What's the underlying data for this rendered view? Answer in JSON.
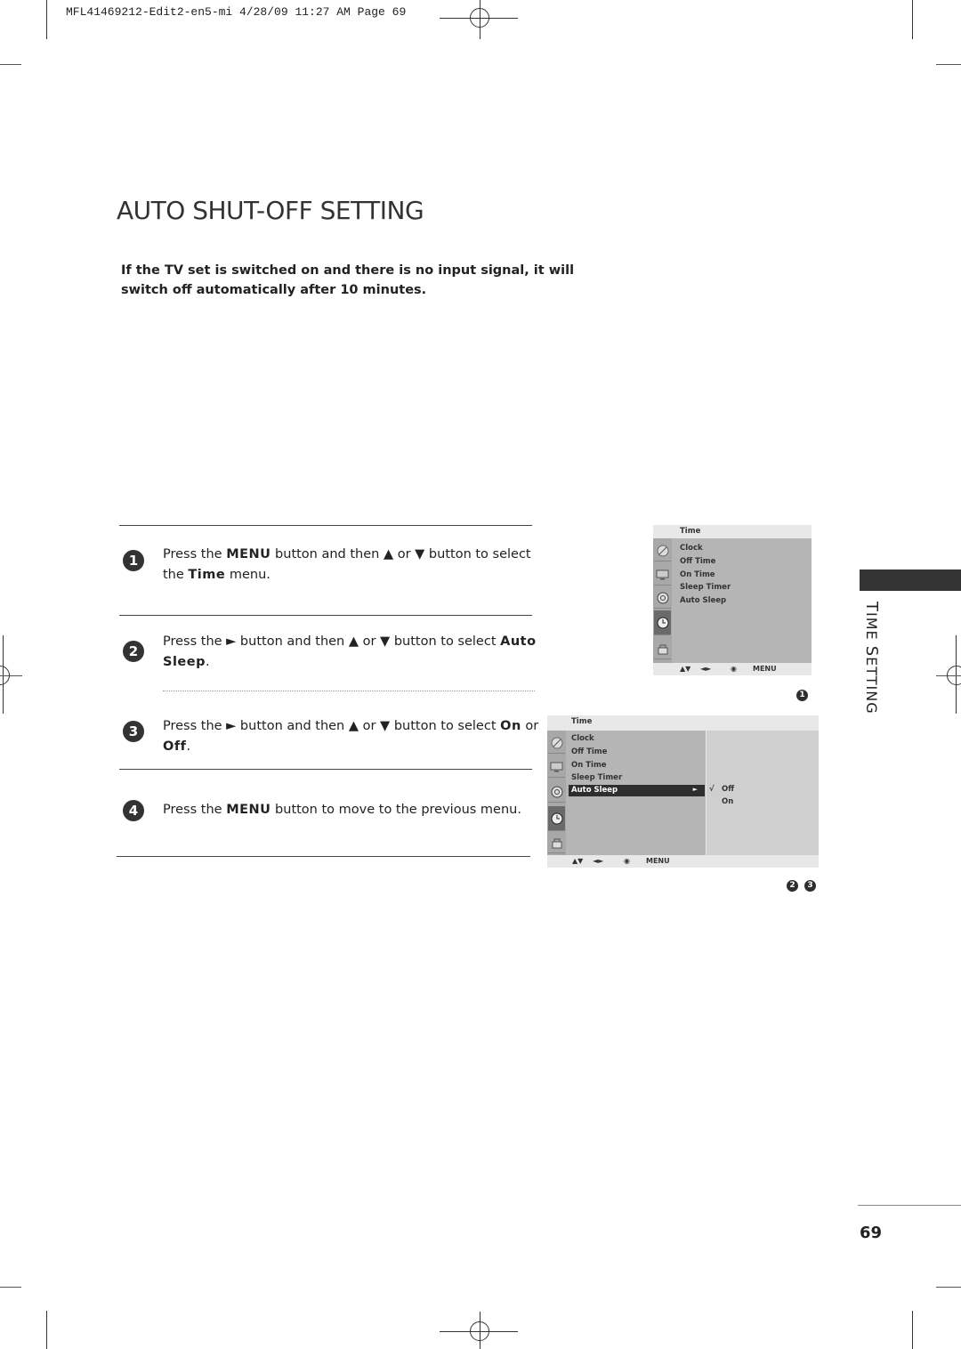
{
  "slug": "MFL41469212-Edit2-en5-mi  4/28/09 11:27 AM  Page 69",
  "title": "AUTO SHUT-OFF SETTING",
  "intro": "If the TV set is switched on and there is no input signal, it will switch off automatically after 10 minutes.",
  "steps": [
    {
      "num": "1",
      "parts": [
        "Press the ",
        "MENU",
        " button and then ▲ or ▼ button to select the ",
        "Time",
        " menu."
      ]
    },
    {
      "num": "2",
      "parts": [
        "Press the ► button and then ▲ or ▼ button to select ",
        "Auto Sleep",
        "."
      ]
    },
    {
      "num": "3",
      "parts": [
        "Press the ► button and then ▲ or ▼ button to select ",
        "On",
        " or ",
        "Off",
        "."
      ]
    },
    {
      "num": "4",
      "parts": [
        "Press the ",
        "MENU",
        " button to move to the previous menu."
      ]
    }
  ],
  "osd1": {
    "header": "Time",
    "items": [
      "Clock",
      "Off Time",
      "On Time",
      "Sleep Timer",
      "Auto Sleep"
    ],
    "side_icons": [
      "satellite-dish-icon",
      "tv-screen-icon",
      "speaker-icon",
      "clock-icon",
      "padlock-icon"
    ],
    "selected_icon_index": 3,
    "footer": {
      "nav_updown": "▲▼",
      "nav_leftright": "◄►",
      "ok": "◉",
      "menu": "MENU"
    },
    "caption_badge": "1"
  },
  "osd2": {
    "header": "Time",
    "items": [
      "Clock",
      "Off Time",
      "On Time",
      "Sleep Timer",
      "Auto Sleep"
    ],
    "highlighted_item": "Auto Sleep",
    "highlight_arrow": "►",
    "submenu": {
      "check": "√",
      "options": [
        "Off",
        "On"
      ],
      "selected": "Off"
    },
    "side_icons": [
      "satellite-dish-icon",
      "tv-screen-icon",
      "speaker-icon",
      "clock-icon",
      "padlock-icon"
    ],
    "selected_icon_index": 3,
    "footer": {
      "nav_updown": "▲▼",
      "nav_leftright": "◄►",
      "ok": "◉",
      "menu": "MENU"
    },
    "caption_badges": [
      "2",
      "3"
    ]
  },
  "side_section": {
    "label_first": "T",
    "label": "IME ",
    "label2_first": "S",
    "label2": "ETTING"
  },
  "page_number": "69"
}
